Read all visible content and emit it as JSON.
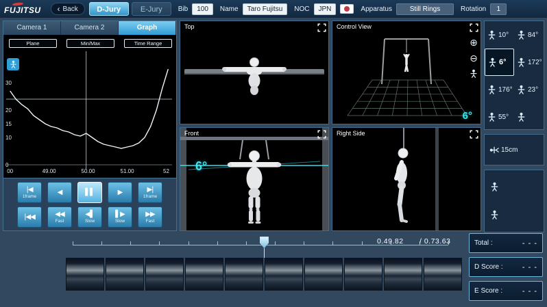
{
  "colors": {
    "accent_blue": "#45aede",
    "cyan": "#3ce0ea",
    "panel_border": "#3f6b8e"
  },
  "icons": {
    "back-arrow": "‹",
    "step-back": "|◀",
    "play-reverse": "◀",
    "pause": "▌▌",
    "play-forward": "▶",
    "step-forward": "▶|",
    "jump-start": "|◀◀",
    "fast-rewind": "◀◀",
    "slow-reverse": "◀▌",
    "slow-forward": "▌▶",
    "fast-forward": "▶▶",
    "zoom-in": "⊕",
    "zoom-out": "⊖"
  },
  "topbar": {
    "logo": "FUJITSU",
    "back_label": "Back",
    "tabs": [
      {
        "label": "D-Jury",
        "active": true
      },
      {
        "label": "E-Jury",
        "active": false
      }
    ],
    "fields": {
      "bib_label": "Bib",
      "bib_value": "100",
      "name_label": "Name",
      "name_value": "Taro Fujitsu",
      "noc_label": "NOC",
      "noc_value": "JPN",
      "apparatus_label": "Apparatus",
      "apparatus_value": "Still Rings",
      "rotation_label": "Rotation",
      "rotation_value": "1"
    }
  },
  "left_panel": {
    "tabs": [
      {
        "label": "Camera 1",
        "active": false
      },
      {
        "label": "Camera 2",
        "active": false
      },
      {
        "label": "Graph",
        "active": true
      }
    ],
    "graph_buttons": [
      "Plane",
      "Min/Max",
      "Time Range"
    ]
  },
  "chart_data": {
    "type": "line",
    "title": "",
    "xlabel": "",
    "ylabel": "",
    "xlim": [
      47.9,
      52.15
    ],
    "ylim": [
      0,
      40
    ],
    "grid": false,
    "legend": false,
    "x_ticks": [
      {
        "v": 48,
        "label": "00"
      },
      {
        "v": 49,
        "label": "49.00"
      },
      {
        "v": 50,
        "label": "50.00"
      },
      {
        "v": 51,
        "label": "51.00"
      },
      {
        "v": 52,
        "label": "52"
      }
    ],
    "y_ticks": [
      {
        "v": 30,
        "label": "30"
      },
      {
        "v": 20,
        "label": "20"
      },
      {
        "v": 15,
        "label": "15"
      },
      {
        "v": 10,
        "label": "10"
      },
      {
        "v": 0,
        "label": "0"
      }
    ],
    "series": [
      {
        "name": "angle",
        "x": [
          48.0,
          48.15,
          48.3,
          48.45,
          48.6,
          48.75,
          48.9,
          49.05,
          49.2,
          49.35,
          49.5,
          49.65,
          49.8,
          49.95,
          50.1,
          50.25,
          50.4,
          50.55,
          50.7,
          50.85,
          51.0,
          51.15,
          51.3,
          51.45,
          51.6,
          51.75,
          51.9,
          52.05
        ],
        "y": [
          27,
          24,
          22,
          20.5,
          18,
          16.5,
          15,
          14,
          13.5,
          12.5,
          12,
          11,
          10.5,
          11.5,
          10,
          8.5,
          7.5,
          7,
          6.5,
          6,
          6.5,
          7,
          8,
          10,
          14,
          20,
          28,
          35
        ]
      }
    ],
    "crosshair": {
      "x": 49.95,
      "y": 24
    }
  },
  "playback": {
    "row1": [
      {
        "icon": "step-back",
        "label": "1frame",
        "active": false
      },
      {
        "icon": "play-reverse",
        "label": "",
        "active": false
      },
      {
        "icon": "pause",
        "label": "",
        "active": true
      },
      {
        "icon": "play-forward",
        "label": "",
        "active": false
      },
      {
        "icon": "step-forward",
        "label": "1frame",
        "active": false
      }
    ],
    "row2": [
      {
        "icon": "jump-start",
        "label": "",
        "active": false
      },
      {
        "icon": "fast-rewind",
        "label": "Fast",
        "active": false
      },
      {
        "icon": "slow-reverse",
        "label": "Slow",
        "active": false
      },
      {
        "icon": "slow-forward",
        "label": "Slow",
        "active": false
      },
      {
        "icon": "fast-forward",
        "label": "Fast",
        "active": false
      }
    ]
  },
  "viewports": {
    "top": {
      "title": "Top"
    },
    "control": {
      "title": "Control View",
      "angle": "6°"
    },
    "front": {
      "title": "Front",
      "angle": "6°"
    },
    "right_side": {
      "title": "Right Side"
    }
  },
  "measurements": {
    "grid": [
      {
        "value": "10°",
        "selected": false
      },
      {
        "value": "84°",
        "selected": false
      },
      {
        "value": "6°",
        "selected": true
      },
      {
        "value": "172°",
        "selected": false
      },
      {
        "value": "176°",
        "selected": false
      },
      {
        "value": "23°",
        "selected": false
      },
      {
        "value": "55°",
        "selected": false
      },
      {
        "value": "",
        "selected": false
      }
    ],
    "mid": [
      {
        "value": "15cm",
        "selected": false
      }
    ],
    "bottom": [
      {
        "value": "",
        "selected": false
      },
      {
        "value": "",
        "selected": false
      }
    ]
  },
  "timeline": {
    "current": "0.49.82",
    "total": "/ 0.73.63",
    "position_pct": 51
  },
  "filmstrip": {
    "count": 10
  },
  "scores": [
    {
      "label": "Total :",
      "value": "- - -"
    },
    {
      "label": "D Score :",
      "value": "- - -"
    },
    {
      "label": "E Score :",
      "value": "- - -"
    }
  ]
}
